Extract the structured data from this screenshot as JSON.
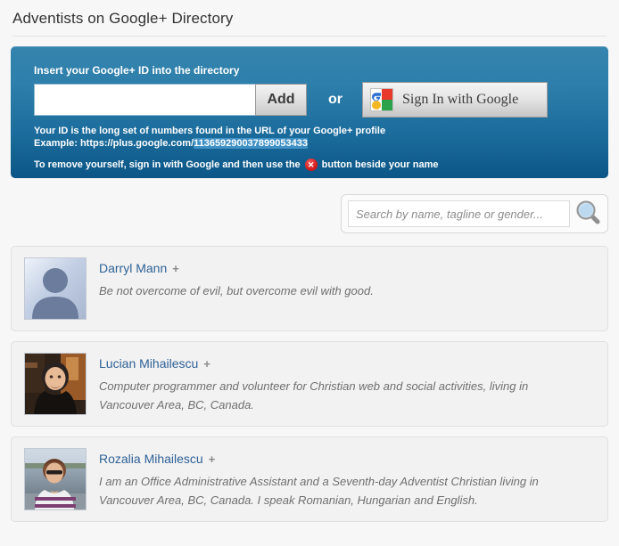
{
  "page": {
    "title": "Adventists on Google+ Directory"
  },
  "banner": {
    "label": "Insert your Google+ ID into the directory",
    "id_input_value": "",
    "id_input_placeholder": "",
    "add_label": "Add",
    "or_label": "or",
    "google_signin_label": "Sign In with Google",
    "help_line1": "Your ID is the long set of numbers found in the URL of your Google+ profile",
    "help_line2_prefix": "Example: https://plus.google.com/",
    "help_line2_id": "113659290037899053433",
    "remove_prefix": "To remove yourself, sign in with Google and then use the",
    "remove_suffix": "button beside your name",
    "x_glyph": "✕",
    "colors": {
      "banner_top": "#3484ae",
      "banner_bottom": "#0b5687",
      "remove_badge": "#d61d1d"
    }
  },
  "search": {
    "value": "",
    "placeholder": "Search by name, tagline or gender..."
  },
  "directory": {
    "entries": [
      {
        "name": "Darryl Mann",
        "plus": "+",
        "tagline": "Be not overcome of evil, but overcome evil with good.",
        "avatar_type": "default-silhouette"
      },
      {
        "name": "Lucian Mihailescu",
        "plus": "+",
        "tagline": "Computer programmer and volunteer for Christian web and social activities, living in Vancouver Area, BC, Canada.",
        "avatar_type": "photo-man"
      },
      {
        "name": "Rozalia Mihailescu",
        "plus": "+",
        "tagline": "I am an Office Administrative Assistant and a Seventh-day Adventist Christian living in Vancouver Area, BC, Canada. I speak Romanian, Hungarian and English.",
        "avatar_type": "photo-woman"
      }
    ]
  }
}
